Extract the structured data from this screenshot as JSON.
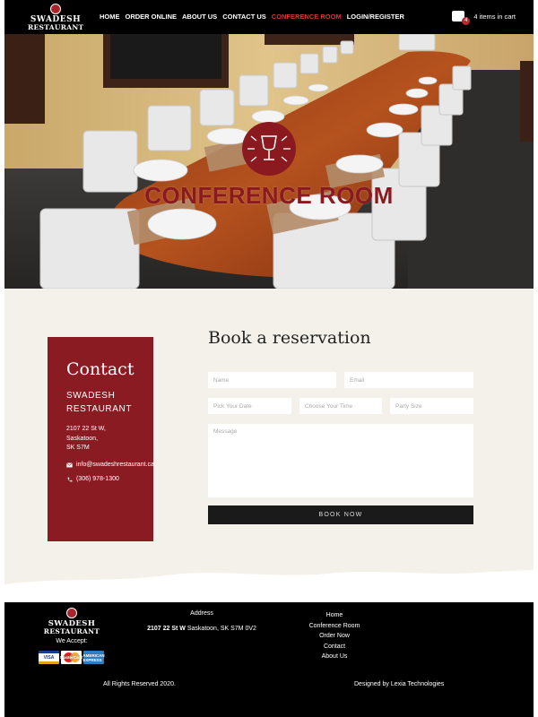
{
  "nav": {
    "logo_line1": "SWADESH",
    "logo_line2": "RESTAURANT",
    "items": [
      {
        "label": "HOME"
      },
      {
        "label": "ORDER ONLINE"
      },
      {
        "label": "ABOUT US"
      },
      {
        "label": "CONTACT US"
      },
      {
        "label": "CONFERENCE ROOM"
      },
      {
        "label": "LOGIN/REGISTER"
      }
    ],
    "active_color": "#d8323a",
    "cart_count": "4",
    "cart_label": "4 items in cart"
  },
  "hero": {
    "title": "CONFERENCE ROOM",
    "title_color": "#8a1a1f",
    "icon": "wine-glass-cutlery-icon"
  },
  "contact": {
    "heading": "Contact",
    "restaurant": "SWADESH RESTAURANT",
    "address_line1": "2107 22 St W,",
    "address_line2": "Saskatoon,",
    "address_line3": "SK S7M",
    "email": "info@swadeshrestaurant.ca",
    "phone": "(306) 978-1300",
    "card_color": "#8b1b22"
  },
  "reservation": {
    "title": "Book a reservation",
    "name_placeholder": "Name",
    "email_placeholder": "Email",
    "date_placeholder": "Pick Your Date",
    "time_placeholder": "Choose Your Time",
    "party_placeholder": "Party Size",
    "message_placeholder": "Message",
    "button_label": "BOOK NOW"
  },
  "footer": {
    "logo_line1": "SWADESH",
    "logo_line2": "RESTAURANT",
    "we_accept": "We Accept:",
    "cards": [
      "VISA",
      "MasterCard",
      "AMERICAN EXPRESS"
    ],
    "address_heading": "Address",
    "address_bold": "2107 22 St W",
    "address_rest": "Saskatoon, SK S7M 0V2",
    "links": [
      "Home",
      "Conference Room",
      "Order Now",
      "Contact",
      "About Us"
    ],
    "copyright": "All Rights Reserved 2020.",
    "designed_by": "Designed by Lexia Technologies"
  }
}
